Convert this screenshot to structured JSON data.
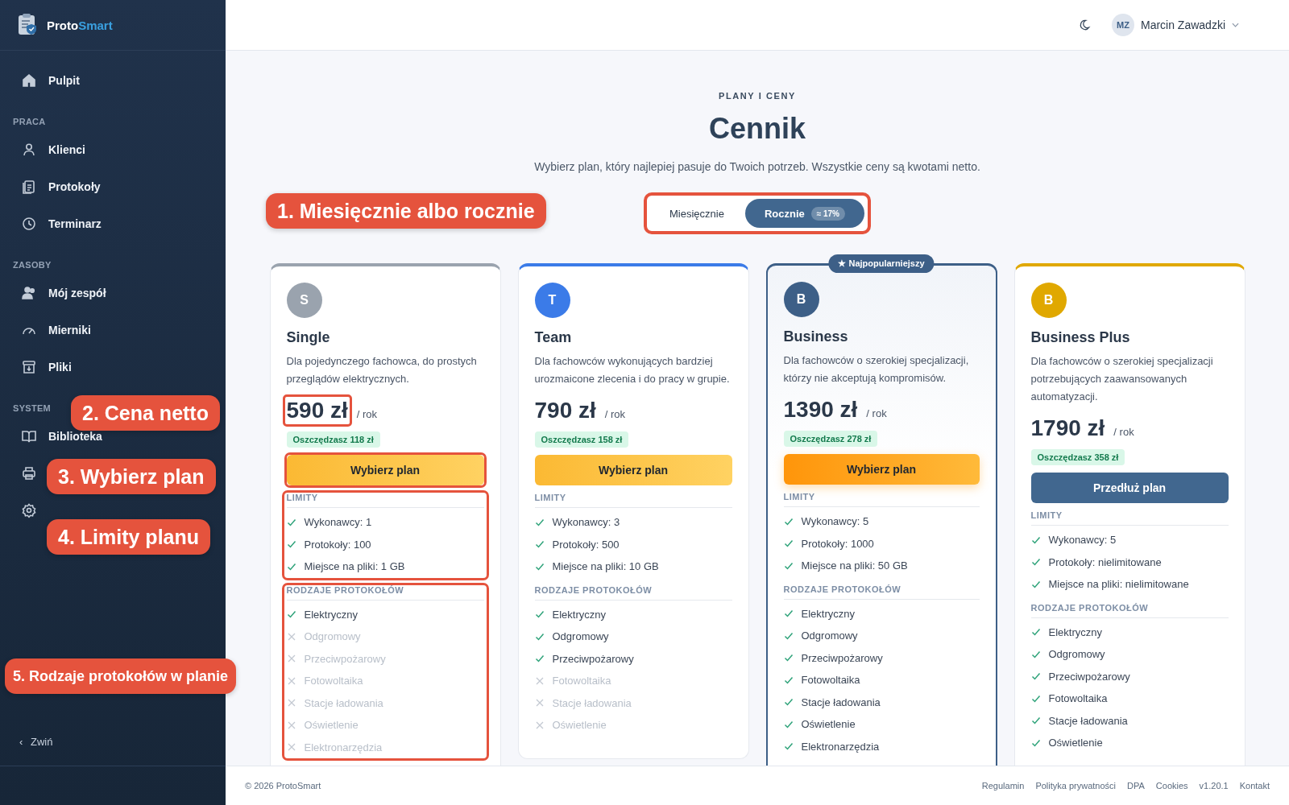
{
  "sidebar": {
    "brand": {
      "part_1": "Proto",
      "part_2": "Smart"
    },
    "groups": [
      {
        "items": [
          {
            "kind": "link",
            "label": "Pulpit"
          }
        ]
      },
      {
        "heading": "PRACA",
        "items": [
          {
            "kind": "link",
            "label": "Klienci"
          },
          {
            "kind": "link",
            "label": "Protokoły"
          },
          {
            "kind": "link",
            "label": "Terminarz"
          }
        ]
      },
      {
        "heading": "ZASOBY",
        "items": [
          {
            "kind": "link",
            "label": "Mój zespół"
          },
          {
            "kind": "link",
            "label": "Mierniki"
          },
          {
            "kind": "link",
            "label": "Pliki"
          }
        ]
      },
      {
        "heading": "SYSTEM",
        "items": [
          {
            "kind": "link",
            "label": "Biblioteka"
          },
          {
            "kind": "icon"
          },
          {
            "kind": "icon"
          }
        ]
      }
    ],
    "collapse": {
      "icon": "‹",
      "label": "Zwiń"
    }
  },
  "header": {
    "user": {
      "initials": "MZ",
      "name": "Marcin Zawadzki"
    }
  },
  "pricing": {
    "eyebrow": "PLANY I CENY",
    "title": "Cennik",
    "subtitle": "Wybierz plan, który najlepiej pasuje do Twoich potrzeb. Wszystkie ceny są kwotami netto.",
    "billing_toggle": {
      "highlighted": true,
      "options": [
        {
          "label": "Miesięcznie",
          "selected": false
        },
        {
          "label": "Rocznie",
          "badge": "≈ 17%",
          "selected": true
        }
      ]
    },
    "plans": [
      {
        "initial": "S",
        "name": "Single",
        "color": "#9aa3ae",
        "description": "Dla pojedynczego fachowca, do prostych przeglądów elektrycznych.",
        "price": "590 zł",
        "period": "/ rok",
        "savings": "Oszczędzasz 118 zł",
        "button": {
          "label": "Wybierz plan",
          "kind": "choose"
        },
        "featured": false,
        "highlight_price": true,
        "highlight_button": true,
        "highlight_limits": true,
        "highlight_types": true,
        "limits_heading": "LIMITY",
        "limits": [
          {
            "text": "Wykonawcy: 1",
            "included": true
          },
          {
            "text": "Protokoły: 100",
            "included": true
          },
          {
            "text": "Miejsce na pliki: 1 GB",
            "included": true
          }
        ],
        "types_heading": "RODZAJE PROTOKOŁÓW",
        "types": [
          {
            "text": "Elektryczny",
            "included": true
          },
          {
            "text": "Odgromowy",
            "included": false
          },
          {
            "text": "Przeciwpożarowy",
            "included": false
          },
          {
            "text": "Fotowoltaika",
            "included": false
          },
          {
            "text": "Stacje ładowania",
            "included": false
          },
          {
            "text": "Oświetlenie",
            "included": false
          },
          {
            "text": "Elektronarzędzia",
            "included": false
          }
        ]
      },
      {
        "initial": "T",
        "name": "Team",
        "color": "#3b7be8",
        "description": "Dla fachowców wykonujących bardziej urozmaicone zlecenia i do pracy w grupie.",
        "price": "790 zł",
        "period": "/ rok",
        "savings": "Oszczędzasz 158 zł",
        "button": {
          "label": "Wybierz plan",
          "kind": "choose"
        },
        "featured": false,
        "highlight_price": false,
        "highlight_button": false,
        "highlight_limits": false,
        "highlight_types": false,
        "limits_heading": "LIMITY",
        "limits": [
          {
            "text": "Wykonawcy: 3",
            "included": true
          },
          {
            "text": "Protokoły: 500",
            "included": true
          },
          {
            "text": "Miejsce na pliki: 10 GB",
            "included": true
          }
        ],
        "types_heading": "RODZAJE PROTOKOŁÓW",
        "types": [
          {
            "text": "Elektryczny",
            "included": true
          },
          {
            "text": "Odgromowy",
            "included": true
          },
          {
            "text": "Przeciwpożarowy",
            "included": true
          },
          {
            "text": "Fotowoltaika",
            "included": false
          },
          {
            "text": "Stacje ładowania",
            "included": false
          },
          {
            "text": "Oświetlenie",
            "included": false
          }
        ]
      },
      {
        "initial": "B",
        "name": "Business",
        "color": "#3d5f87",
        "description": "Dla fachowców o szerokiej specjalizacji, którzy nie akceptują kompromisów.",
        "price": "1390 zł",
        "period": "/ rok",
        "savings": "Oszczędzasz 278 zł",
        "button": {
          "label": "Wybierz plan",
          "kind": "popular"
        },
        "featured": true,
        "badge": "★ Najpopularniejszy",
        "highlight_price": false,
        "highlight_button": false,
        "highlight_limits": false,
        "highlight_types": false,
        "limits_heading": "LIMITY",
        "limits": [
          {
            "text": "Wykonawcy: 5",
            "included": true
          },
          {
            "text": "Protokoły: 1000",
            "included": true
          },
          {
            "text": "Miejsce na pliki: 50 GB",
            "included": true
          }
        ],
        "types_heading": "RODZAJE PROTOKOŁÓW",
        "types": [
          {
            "text": "Elektryczny",
            "included": true
          },
          {
            "text": "Odgromowy",
            "included": true
          },
          {
            "text": "Przeciwpożarowy",
            "included": true
          },
          {
            "text": "Fotowoltaika",
            "included": true
          },
          {
            "text": "Stacje ładowania",
            "included": true
          },
          {
            "text": "Oświetlenie",
            "included": true
          },
          {
            "text": "Elektronarzędzia",
            "included": true
          }
        ]
      },
      {
        "initial": "B",
        "name": "Business Plus",
        "color": "#e0a800",
        "description": "Dla fachowców o szerokiej specjalizacji potrzebujących zaawansowanych automatyzacji.",
        "price": "1790 zł",
        "period": "/ rok",
        "savings": "Oszczędzasz 358 zł",
        "button": {
          "label": "Przedłuż plan",
          "kind": "renew"
        },
        "featured": false,
        "highlight_price": false,
        "highlight_button": false,
        "highlight_limits": false,
        "highlight_types": false,
        "limits_heading": "LIMITY",
        "limits": [
          {
            "text": "Wykonawcy: 5",
            "included": true
          },
          {
            "text": "Protokoły: nielimitowane",
            "included": true
          },
          {
            "text": "Miejsce na pliki: nielimitowane",
            "included": true
          }
        ],
        "types_heading": "RODZAJE PROTOKOŁÓW",
        "types": [
          {
            "text": "Elektryczny",
            "included": true
          },
          {
            "text": "Odgromowy",
            "included": true
          },
          {
            "text": "Przeciwpożarowy",
            "included": true
          },
          {
            "text": "Fotowoltaika",
            "included": true
          },
          {
            "text": "Stacje ładowania",
            "included": true
          },
          {
            "text": "Oświetlenie",
            "included": true
          }
        ]
      }
    ]
  },
  "footer": {
    "copyright": "© 2026 ProtoSmart",
    "links": [
      "Regulamin",
      "Polityka prywatności",
      "DPA",
      "Cookies",
      "v1.20.1",
      "Kontakt"
    ]
  },
  "callouts": [
    "1. Miesięcznie albo rocznie",
    "2. Cena netto",
    "3. Wybierz plan",
    "4. Limity planu",
    "5. Rodzaje protokołów w planie"
  ]
}
